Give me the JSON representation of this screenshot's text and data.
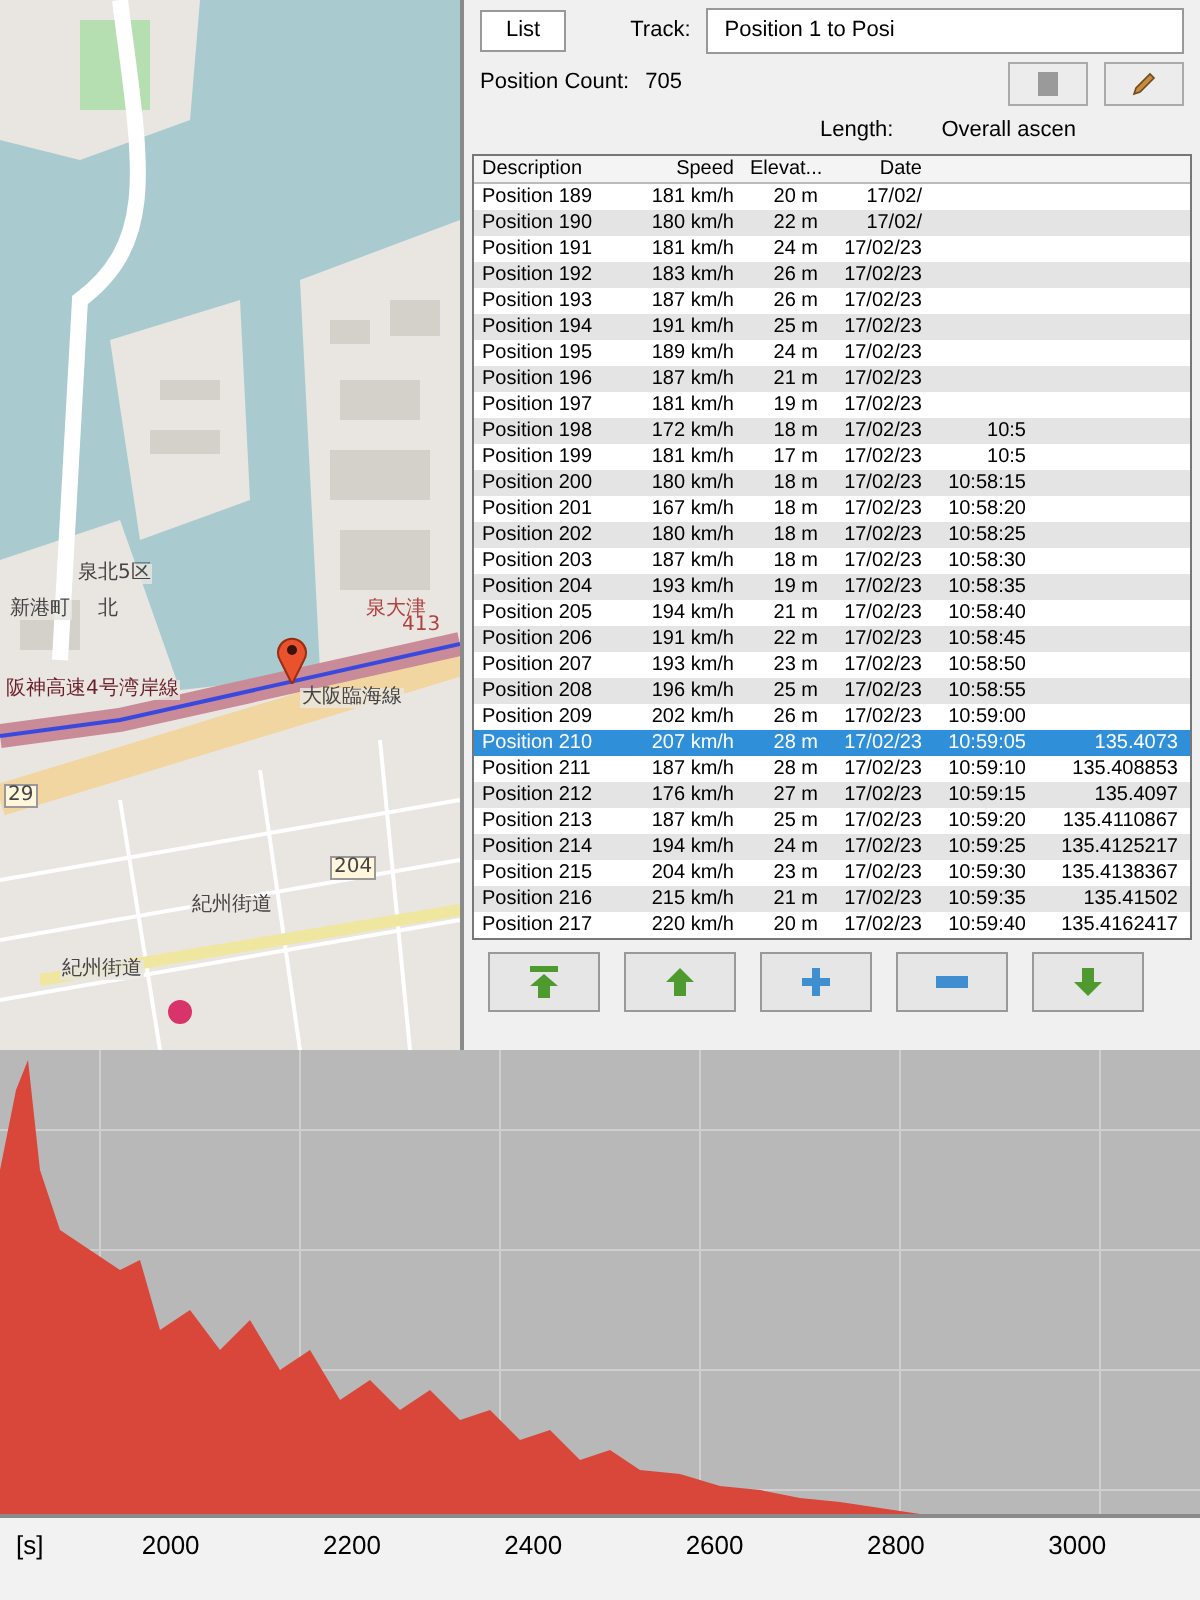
{
  "map": {
    "labels": [
      {
        "text": "泉北5区"
      },
      {
        "text": "新港町"
      },
      {
        "text": "北"
      },
      {
        "text": "泉大津"
      },
      {
        "text": "413"
      },
      {
        "text": "阪神高速4号湾岸線"
      },
      {
        "text": "大阪臨海線"
      },
      {
        "text": "29"
      },
      {
        "text": "204"
      },
      {
        "text": "紀州街道"
      },
      {
        "text": "紀州街道"
      }
    ]
  },
  "panel": {
    "tab": "List",
    "track_label": "Track:",
    "track_value": "Position 1 to Posi",
    "position_count_label": "Position Count:",
    "position_count": "705",
    "length_label": "Length:",
    "ascent_label": "Overall ascen"
  },
  "table": {
    "columns": [
      "Description",
      "Speed",
      "Elevat...",
      "Date"
    ],
    "rows": [
      {
        "selected": false,
        "description": "Position 189",
        "speed": "181 km/h",
        "elevation": "20 m",
        "date": "17/02/"
      },
      {
        "selected": false,
        "description": "Position 190",
        "speed": "180 km/h",
        "elevation": "22 m",
        "date": "17/02/"
      },
      {
        "selected": false,
        "description": "Position 191",
        "speed": "181 km/h",
        "elevation": "24 m",
        "date": "17/02/23"
      },
      {
        "selected": false,
        "description": "Position 192",
        "speed": "183 km/h",
        "elevation": "26 m",
        "date": "17/02/23"
      },
      {
        "selected": false,
        "description": "Position 193",
        "speed": "187 km/h",
        "elevation": "26 m",
        "date": "17/02/23"
      },
      {
        "selected": false,
        "description": "Position 194",
        "speed": "191 km/h",
        "elevation": "25 m",
        "date": "17/02/23"
      },
      {
        "selected": false,
        "description": "Position 195",
        "speed": "189 km/h",
        "elevation": "24 m",
        "date": "17/02/23"
      },
      {
        "selected": false,
        "description": "Position 196",
        "speed": "187 km/h",
        "elevation": "21 m",
        "date": "17/02/23"
      },
      {
        "selected": false,
        "description": "Position 197",
        "speed": "181 km/h",
        "elevation": "19 m",
        "date": "17/02/23"
      },
      {
        "selected": false,
        "description": "Position 198",
        "speed": "172 km/h",
        "elevation": "18 m",
        "date": "17/02/23",
        "time": "10:5"
      },
      {
        "selected": false,
        "description": "Position 199",
        "speed": "181 km/h",
        "elevation": "17 m",
        "date": "17/02/23",
        "time": "10:5"
      },
      {
        "selected": false,
        "description": "Position 200",
        "speed": "180 km/h",
        "elevation": "18 m",
        "date": "17/02/23",
        "time": "10:58:15"
      },
      {
        "selected": false,
        "description": "Position 201",
        "speed": "167 km/h",
        "elevation": "18 m",
        "date": "17/02/23",
        "time": "10:58:20"
      },
      {
        "selected": false,
        "description": "Position 202",
        "speed": "180 km/h",
        "elevation": "18 m",
        "date": "17/02/23",
        "time": "10:58:25"
      },
      {
        "selected": false,
        "description": "Position 203",
        "speed": "187 km/h",
        "elevation": "18 m",
        "date": "17/02/23",
        "time": "10:58:30"
      },
      {
        "selected": false,
        "description": "Position 204",
        "speed": "193 km/h",
        "elevation": "19 m",
        "date": "17/02/23",
        "time": "10:58:35"
      },
      {
        "selected": false,
        "description": "Position 205",
        "speed": "194 km/h",
        "elevation": "21 m",
        "date": "17/02/23",
        "time": "10:58:40"
      },
      {
        "selected": false,
        "description": "Position 206",
        "speed": "191 km/h",
        "elevation": "22 m",
        "date": "17/02/23",
        "time": "10:58:45"
      },
      {
        "selected": false,
        "description": "Position 207",
        "speed": "193 km/h",
        "elevation": "23 m",
        "date": "17/02/23",
        "time": "10:58:50"
      },
      {
        "selected": false,
        "description": "Position 208",
        "speed": "196 km/h",
        "elevation": "25 m",
        "date": "17/02/23",
        "time": "10:58:55"
      },
      {
        "selected": false,
        "description": "Position 209",
        "speed": "202 km/h",
        "elevation": "26 m",
        "date": "17/02/23",
        "time": "10:59:00"
      },
      {
        "selected": true,
        "description": "Position 210",
        "speed": "207 km/h",
        "elevation": "28 m",
        "date": "17/02/23",
        "time": "10:59:05",
        "longitude": "135.4073"
      },
      {
        "selected": false,
        "description": "Position 211",
        "speed": "187 km/h",
        "elevation": "28 m",
        "date": "17/02/23",
        "time": "10:59:10",
        "longitude": "135.408853"
      },
      {
        "selected": false,
        "description": "Position 212",
        "speed": "176 km/h",
        "elevation": "27 m",
        "date": "17/02/23",
        "time": "10:59:15",
        "longitude": "135.4097"
      },
      {
        "selected": false,
        "description": "Position 213",
        "speed": "187 km/h",
        "elevation": "25 m",
        "date": "17/02/23",
        "time": "10:59:20",
        "longitude": "135.4110867"
      },
      {
        "selected": false,
        "description": "Position 214",
        "speed": "194 km/h",
        "elevation": "24 m",
        "date": "17/02/23",
        "time": "10:59:25",
        "longitude": "135.4125217"
      },
      {
        "selected": false,
        "description": "Position 215",
        "speed": "204 km/h",
        "elevation": "23 m",
        "date": "17/02/23",
        "time": "10:59:30",
        "longitude": "135.4138367"
      },
      {
        "selected": false,
        "description": "Position 216",
        "speed": "215 km/h",
        "elevation": "21 m",
        "date": "17/02/23",
        "time": "10:59:35",
        "longitude": "135.41502"
      },
      {
        "selected": false,
        "description": "Position 217",
        "speed": "220 km/h",
        "elevation": "20 m",
        "date": "17/02/23",
        "time": "10:59:40",
        "longitude": "135.4162417"
      }
    ]
  },
  "buttons": [
    {
      "kind": "top"
    },
    {
      "kind": "up"
    },
    {
      "kind": "add"
    },
    {
      "kind": "remove"
    },
    {
      "kind": "down"
    }
  ],
  "profile": {
    "unit": "[s]",
    "x_labels": [
      "2000",
      "2200",
      "2400",
      "2600",
      "2800",
      "3000"
    ]
  }
}
